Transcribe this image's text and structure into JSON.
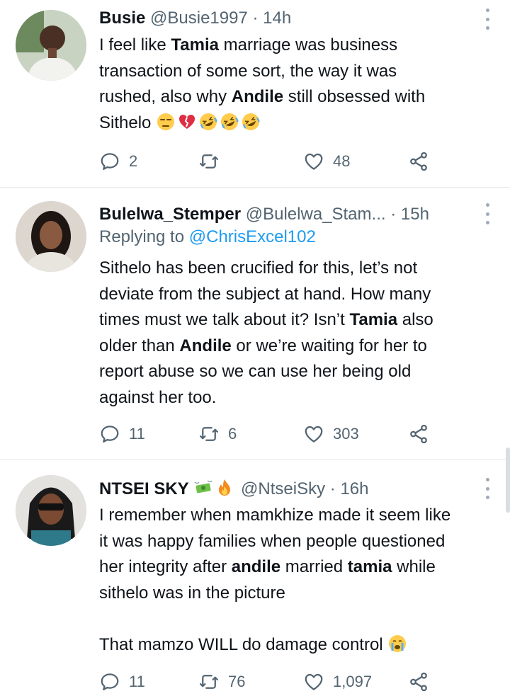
{
  "tweets": [
    {
      "name": "Busie",
      "handle": "@Busie1997",
      "time": "14h",
      "reply_label": "",
      "reply_to": "",
      "lines": [
        [
          "I feel like ",
          {
            "b": "Tamia"
          },
          " marriage was business"
        ],
        [
          "transaction of some sort, the way it was"
        ],
        [
          "rushed, also why ",
          {
            "b": "Andile"
          },
          " still obsessed with"
        ],
        [
          "Sithelo ",
          {
            "e": "unamused"
          },
          {
            "e": "broken-heart"
          },
          {
            "e": "rofl"
          },
          {
            "e": "rofl"
          },
          {
            "e": "rofl"
          }
        ]
      ],
      "stats": {
        "replies": "2",
        "retweets": "",
        "likes": "48"
      }
    },
    {
      "name": "Bulelwa_Stemper",
      "handle": "@Bulelwa_Stam...",
      "time": "15h",
      "reply_label": "Replying to ",
      "reply_to": "@ChrisExcel102",
      "lines": [
        [
          "Sithelo has been crucified for this, let’s not"
        ],
        [
          "deviate from the subject at hand. How many"
        ],
        [
          "times must we talk about it? Isn’t ",
          {
            "b": "Tamia"
          },
          " also"
        ],
        [
          "older than ",
          {
            "b": "Andile"
          },
          " or we’re waiting for her to"
        ],
        [
          "report abuse so we can use her being old"
        ],
        [
          "against her too."
        ]
      ],
      "stats": {
        "replies": "11",
        "retweets": "6",
        "likes": "303"
      }
    },
    {
      "name": "NTSEI SKY",
      "name_emojis": [
        "money-wings",
        "fire"
      ],
      "handle": "@NtseiSky",
      "time": "16h",
      "reply_label": "",
      "reply_to": "",
      "lines": [
        [
          "I remember when mamkhize made it seem like"
        ],
        [
          "it was happy families when people questioned"
        ],
        [
          "her integrity after ",
          {
            "b": "andile"
          },
          " married ",
          {
            "b": "tamia"
          },
          " while"
        ],
        [
          "sithelo was in the picture"
        ],
        [
          ""
        ],
        [
          "That mamzo WILL do damage control ",
          {
            "e": "crying"
          }
        ]
      ],
      "stats": {
        "replies": "11",
        "retweets": "76",
        "likes": "1,097"
      }
    }
  ],
  "colors": {
    "text": "#0f1419",
    "muted": "#536471",
    "link": "#1d9bf0",
    "divider": "#e6e9ec"
  },
  "icons": [
    "reply-icon",
    "retweet-icon",
    "like-icon",
    "share-icon",
    "more-icon"
  ]
}
